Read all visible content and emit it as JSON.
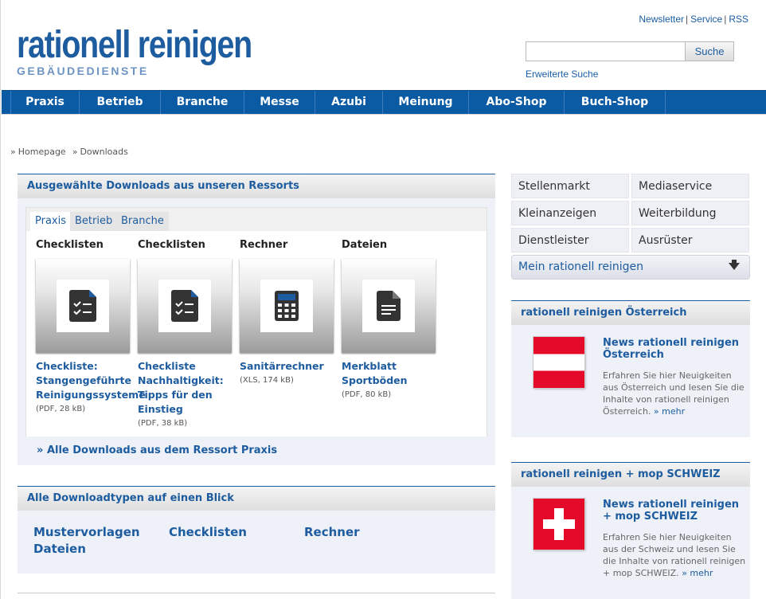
{
  "header": {
    "toplinks": [
      "Newsletter",
      "Service",
      "RSS"
    ],
    "logo_main": "rationell reinigen",
    "logo_sub": "GEBÄUDEDIENSTE",
    "search_placeholder": "",
    "search_button": "Suche",
    "advanced_search": "Erweiterte Suche"
  },
  "nav": [
    "Praxis",
    "Betrieb",
    "Branche",
    "Messe",
    "Azubi",
    "Meinung",
    "Abo-Shop",
    "Buch-Shop"
  ],
  "breadcrumb": [
    "Homepage",
    "Downloads"
  ],
  "downloads_panel": {
    "title": "Ausgewählte Downloads aus unseren Ressorts",
    "tabs": [
      "Praxis",
      "Betrieb",
      "Branche"
    ],
    "items": [
      {
        "category": "Checklisten",
        "icon": "checklist-icon",
        "title": "Checkliste: Stangengeführte Reinigungssysteme",
        "meta": "(PDF, 28 kB)"
      },
      {
        "category": "Checklisten",
        "icon": "checklist-icon",
        "title": "Checkliste Nachhaltigkeit: Tipps für den Einstieg",
        "meta": "(PDF, 38 kB)"
      },
      {
        "category": "Rechner",
        "icon": "calculator-icon",
        "title": "Sanitärrechner",
        "meta": "(XLS, 174 kB)"
      },
      {
        "category": "Dateien",
        "icon": "document-icon",
        "title": "Merkblatt Sportböden",
        "meta": "(PDF, 80 kB)"
      }
    ],
    "all_link": "Alle Downloads aus dem Ressort Praxis"
  },
  "types_panel": {
    "title": "Alle Downloadtypen auf einen Blick",
    "links": [
      "Mustervorlagen",
      "Checklisten",
      "Rechner",
      "Dateien"
    ]
  },
  "side_grid": [
    "Stellenmarkt",
    "Mediaservice",
    "Kleinanzeigen",
    "Weiterbildung",
    "Dienstleister",
    "Ausrüster"
  ],
  "mein": "Mein rationell reinigen",
  "austria": {
    "head": "rationell reinigen Österreich",
    "title": "News rationell reinigen Österreich",
    "text": "Erfahren Sie hier Neuigkeiten aus Österreich und lesen Sie die Inhalte von rationell reinigen Österreich.",
    "more": "mehr"
  },
  "swiss": {
    "head": "rationell reinigen + mop SCHWEIZ",
    "title": "News rationell reinigen + mop SCHWEIZ",
    "text": "Erfahren Sie hier Neuigkeiten aus der Schweiz und lesen Sie die Inhalte von rationell reinigen + mop SCHWEIZ.",
    "more": "mehr"
  },
  "colors": {
    "brand": "#1d5c9f",
    "nav": "#0a5aa4",
    "panel": "#eef1f8"
  }
}
